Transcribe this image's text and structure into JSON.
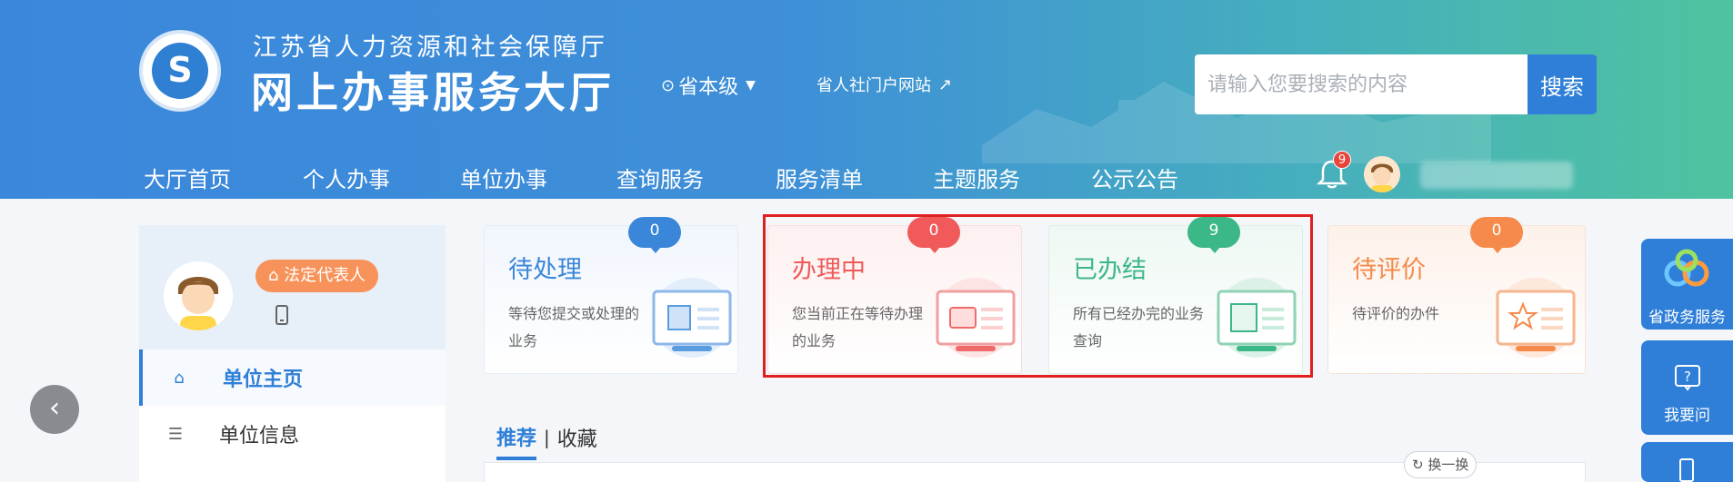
{
  "header": {
    "org_name": "江苏省人力资源和社会保障厅",
    "hall_name": "网上办事服务大厅",
    "region": "省本级",
    "portal_link": "省人社门户网站",
    "search_placeholder": "请输入您要搜索的内容",
    "search_button": "搜索",
    "notification_count": "9"
  },
  "nav": {
    "items": [
      "大厅首页",
      "个人办事",
      "单位办事",
      "查询服务",
      "服务清单",
      "主题服务",
      "公示公告"
    ]
  },
  "profile": {
    "badge": "法定代表人"
  },
  "sidebar": {
    "items": [
      {
        "label": "单位主页",
        "icon": "home-icon"
      },
      {
        "label": "单位信息",
        "icon": "document-icon"
      }
    ]
  },
  "cards": [
    {
      "title": "待处理",
      "desc": "等待您提交或处理的业务",
      "count": "0",
      "color": "#3a86d8"
    },
    {
      "title": "办理中",
      "desc": "您当前正在等待办理的业务",
      "count": "0",
      "color": "#f05a5a"
    },
    {
      "title": "已办结",
      "desc": "所有已经办完的业务查询",
      "count": "9",
      "color": "#3cb787"
    },
    {
      "title": "待评价",
      "desc": "待评价的办件",
      "count": "0",
      "color": "#f58a4a"
    }
  ],
  "tabs": {
    "recommend": "推荐",
    "separator": "|",
    "favorites": "收藏",
    "refresh": "换一换"
  },
  "float_panel": {
    "gov_service": "省政务服务",
    "ask": "我要问"
  }
}
